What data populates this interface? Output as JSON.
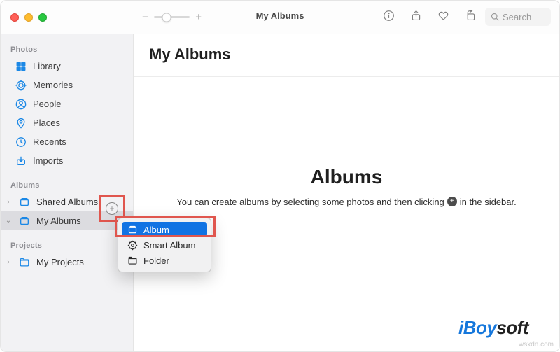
{
  "window": {
    "title": "My Albums"
  },
  "search": {
    "placeholder": "Search"
  },
  "sidebar": {
    "sections": {
      "photos": "Photos",
      "albums": "Albums",
      "projects": "Projects"
    },
    "photos_items": [
      {
        "label": "Library"
      },
      {
        "label": "Memories"
      },
      {
        "label": "People"
      },
      {
        "label": "Places"
      },
      {
        "label": "Recents"
      },
      {
        "label": "Imports"
      }
    ],
    "albums_items": [
      {
        "label": "Shared Albums"
      },
      {
        "label": "My Albums"
      }
    ],
    "projects_items": [
      {
        "label": "My Projects"
      }
    ]
  },
  "context_menu": {
    "items": [
      {
        "label": "Album",
        "highlight": true
      },
      {
        "label": "Smart Album",
        "highlight": false
      },
      {
        "label": "Folder",
        "highlight": false
      }
    ]
  },
  "main": {
    "page_title": "My Albums",
    "placeholder_title": "Albums",
    "placeholder_before": "You can create albums by selecting some photos and then clicking",
    "placeholder_after": "in the sidebar."
  },
  "watermark": {
    "brand_a": "iBoy",
    "brand_b": "soft",
    "domain": "wsxdn.com"
  }
}
